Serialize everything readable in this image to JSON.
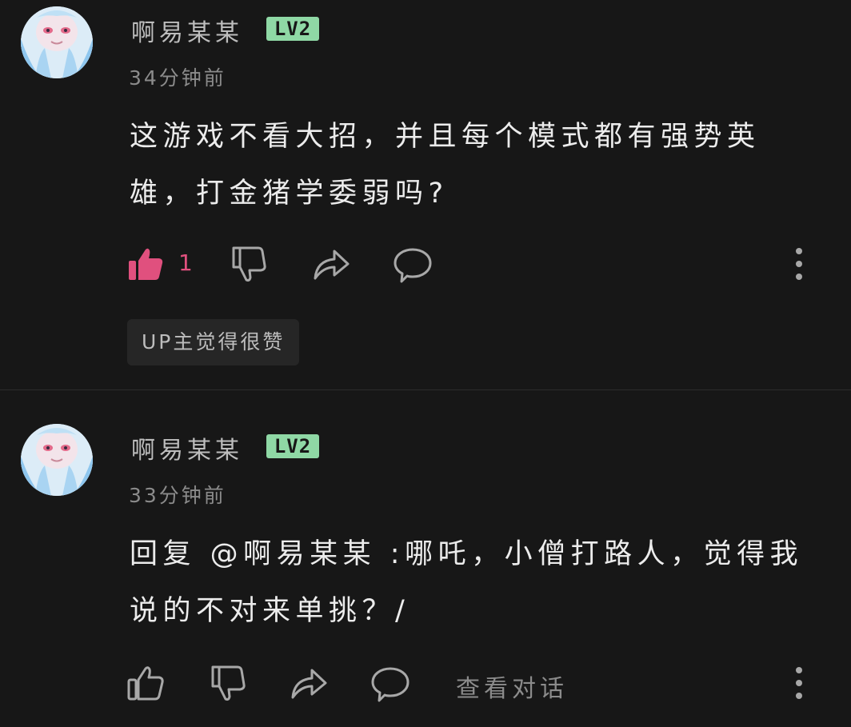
{
  "comments": [
    {
      "username": "啊易某某",
      "level": "LV2",
      "time": "34分钟前",
      "content": "这游戏不看大招，并且每个模式都有强势英雄，打金猪学委弱吗?",
      "like_count": "1",
      "liked": true,
      "up_badge": "UP主觉得很赞"
    },
    {
      "username": "啊易某某",
      "level": "LV2",
      "time": "33分钟前",
      "reply_prefix": "回复 ",
      "mention": "@啊易某某",
      "content": " :哪吒，小僧打路人，觉得我说的不对来单挑？/",
      "view_conversation": "查看对话",
      "liked": false
    }
  ],
  "colors": {
    "background": "#171717",
    "like_active": "#e0507e",
    "level_badge": "#8fd8a5",
    "icon_gray": "#a8a8a8"
  },
  "icons": [
    "thumbs-up-icon",
    "thumbs-down-icon",
    "share-icon",
    "comment-icon",
    "more-vertical-icon"
  ]
}
